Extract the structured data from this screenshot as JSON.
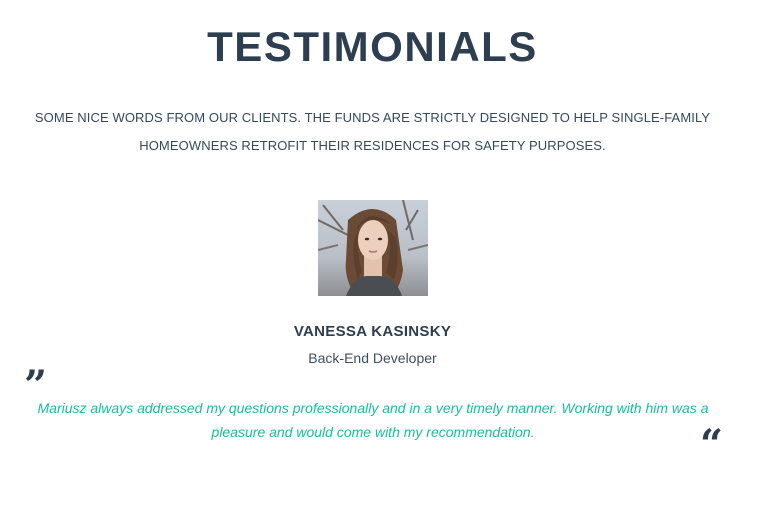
{
  "section": {
    "title": "TESTIMONIALS",
    "subtitle": "SOME NICE WORDS FROM OUR CLIENTS. THE FUNDS ARE STRICTLY DESIGNED TO HELP SINGLE-FAMILY HOMEOWNERS RETROFIT THEIR RESIDENCES FOR SAFETY PURPOSES."
  },
  "testimonial": {
    "name": "VANESSA KASINSKY",
    "role": "Back-End Developer",
    "quote": "Mariusz always addressed my questions professionally and in a very timely manner. Working with him was a pleasure and would come with my recommendation.",
    "open_mark": "”",
    "close_mark": "“"
  },
  "colors": {
    "heading": "#2c3e50",
    "accent": "#1abc9c"
  }
}
